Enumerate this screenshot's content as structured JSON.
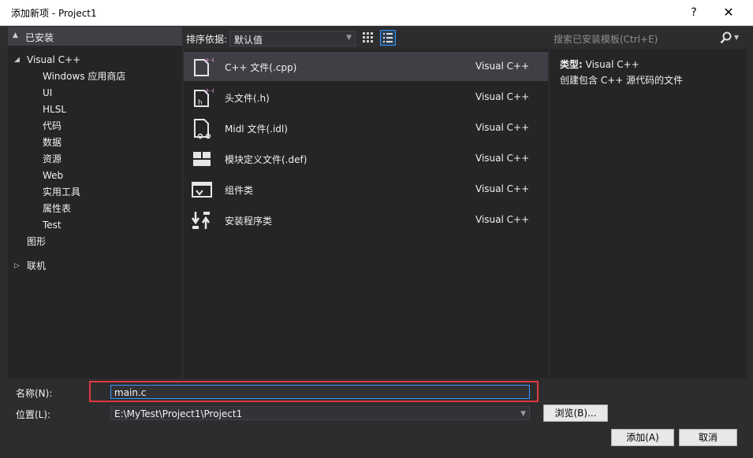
{
  "window": {
    "title": "添加新项 - Project1",
    "help": "?",
    "close": "✕"
  },
  "left": {
    "installed": "已安装",
    "tree": [
      {
        "label": "Visual C++",
        "level": 0,
        "expanded": true
      },
      {
        "label": "Windows 应用商店",
        "level": 1
      },
      {
        "label": "UI",
        "level": 1
      },
      {
        "label": "HLSL",
        "level": 1
      },
      {
        "label": "代码",
        "level": 1
      },
      {
        "label": "数据",
        "level": 1
      },
      {
        "label": "资源",
        "level": 1
      },
      {
        "label": "Web",
        "level": 1
      },
      {
        "label": "实用工具",
        "level": 1
      },
      {
        "label": "属性表",
        "level": 1
      },
      {
        "label": "Test",
        "level": 1
      },
      {
        "label": "图形",
        "level": 1
      },
      {
        "label": "联机",
        "level": 0,
        "expanded": false
      }
    ]
  },
  "toolbar": {
    "sort_label": "排序依据:",
    "sort_value": "默认值"
  },
  "items": [
    {
      "name": "C++ 文件(.cpp)",
      "type": "Visual C++",
      "icon": "cpp-file-icon",
      "selected": true
    },
    {
      "name": "头文件(.h)",
      "type": "Visual C++",
      "icon": "header-file-icon",
      "selected": false
    },
    {
      "name": "Midl 文件(.idl)",
      "type": "Visual C++",
      "icon": "midl-file-icon",
      "selected": false
    },
    {
      "name": "模块定义文件(.def)",
      "type": "Visual C++",
      "icon": "module-def-icon",
      "selected": false
    },
    {
      "name": "组件类",
      "type": "Visual C++",
      "icon": "component-class-icon",
      "selected": false
    },
    {
      "name": "安装程序类",
      "type": "Visual C++",
      "icon": "installer-class-icon",
      "selected": false
    }
  ],
  "search": {
    "placeholder": "搜索已安装模板(Ctrl+E)"
  },
  "details": {
    "type_key": "类型:",
    "type_value": "Visual C++",
    "description": "创建包含 C++ 源代码的文件"
  },
  "form": {
    "name_label": "名称(N):",
    "name_value": "main.c",
    "location_label": "位置(L):",
    "location_value": "E:\\MyTest\\Project1\\Project1",
    "browse": "浏览(B)...",
    "add": "添加(A)",
    "cancel": "取消"
  }
}
